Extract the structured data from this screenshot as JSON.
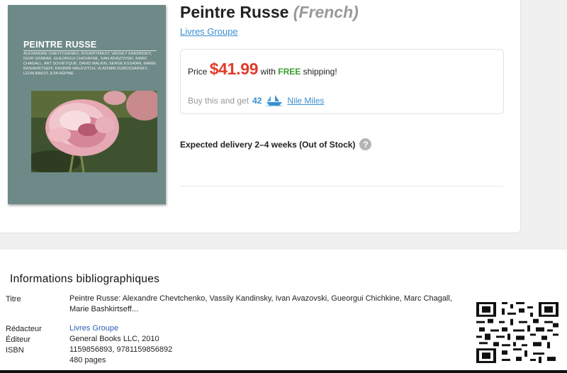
{
  "book": {
    "title": "Peintre Russe",
    "language": "(French)",
    "author": "Livres Groupe"
  },
  "cover": {
    "title": "PEINTRE RUSSE",
    "authors": "ALEXANDRE CHEVTCHENKO, KOUKRYNIKSY, VASSILY KANDINSKY, IGOR GRABAR, GUEORGUI CHICHKINE, IVAN AÏVAZOVSKI, MARC CHAGALL, ART SOVIÉTIQUE, DAVID MALKIN, SERGE ESSAÏAN, MARIE BASHKIRTSEFF, KASIMIR MALEVITCH, VLADIMIR DUBOSSARSKY, LÉON BAKST, ILYA RÉPINE",
    "background_color": "#6e8a88"
  },
  "pricing": {
    "price_prefix": "Price",
    "price": "$41.99",
    "shipping_prefix": "with",
    "free_label": "FREE",
    "shipping_suffix": "shipping!",
    "miles_prefix": "Buy this and get",
    "miles_count": "42",
    "miles_icon": "boat-icon",
    "miles_label": "Nile Miles",
    "price_color": "#e03c2a",
    "free_color": "#38a02d",
    "link_color": "#3a8fd0"
  },
  "delivery": {
    "text": "Expected delivery 2–4 weeks (Out of Stock)",
    "help_icon": "?"
  },
  "bibliography": {
    "heading": "Informations bibliographiques",
    "title_label": "Titre",
    "title_value": "Peintre Russe: Alexandre Chevtchenko, Vassily Kandinsky, Ivan Avazovski, Gueorgui Chichkine, Marc Chagall, Marie Bashkirtseff...",
    "editor_label": "Rédacteur",
    "editor_value": "Livres Groupe",
    "publisher_label": "Éditeur",
    "publisher_value": "General Books LLC, 2010",
    "isbn_label": "ISBN",
    "isbn_value": "1159856893, 9781159856892",
    "pages_value": "480 pages"
  }
}
